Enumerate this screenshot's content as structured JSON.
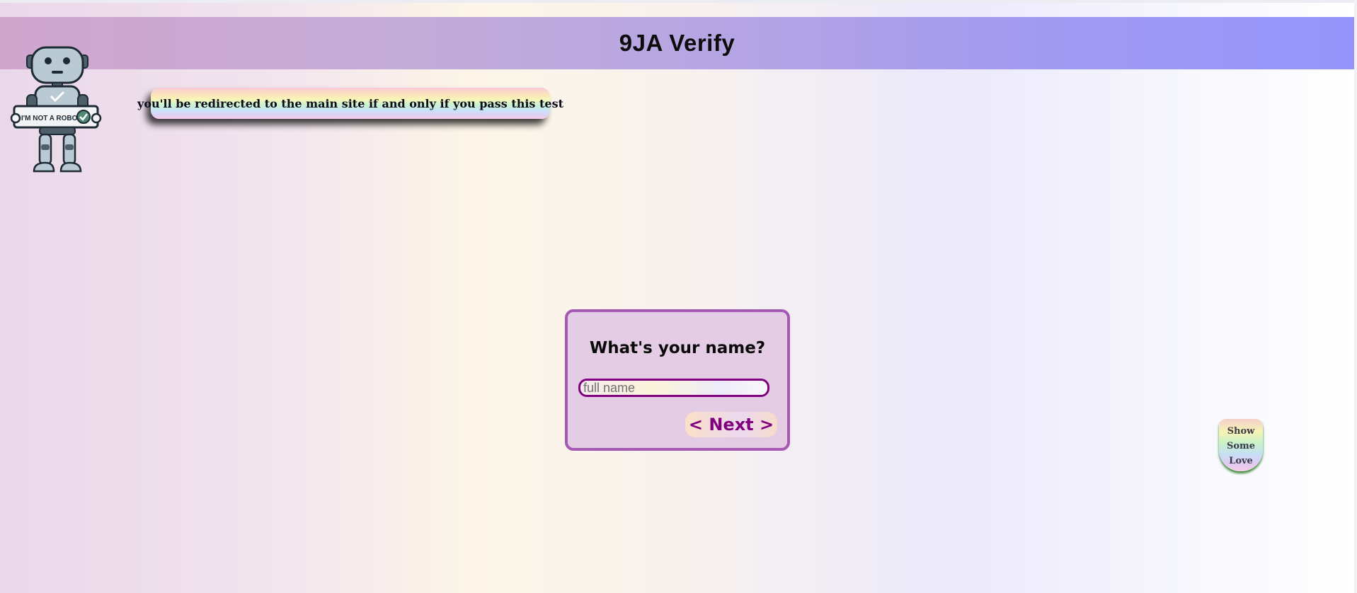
{
  "header": {
    "title": "9JA Verify"
  },
  "robot": {
    "sign_text": "I'M NOT A ROBOT"
  },
  "notice": {
    "text": "you'll be redirected to the main site if and only if you pass this test"
  },
  "form": {
    "question": "What's your name?",
    "name_placeholder": "full name",
    "name_value": "",
    "next_label": "< Next >"
  },
  "love_button": {
    "line1": "Show",
    "line2": "Some",
    "line3": "Love"
  },
  "colors": {
    "accent": "#800080",
    "card_border": "#a45ab3",
    "card_bg": "#e4cce4",
    "header_start": "#d0a6cd",
    "header_end": "#9494fb"
  }
}
